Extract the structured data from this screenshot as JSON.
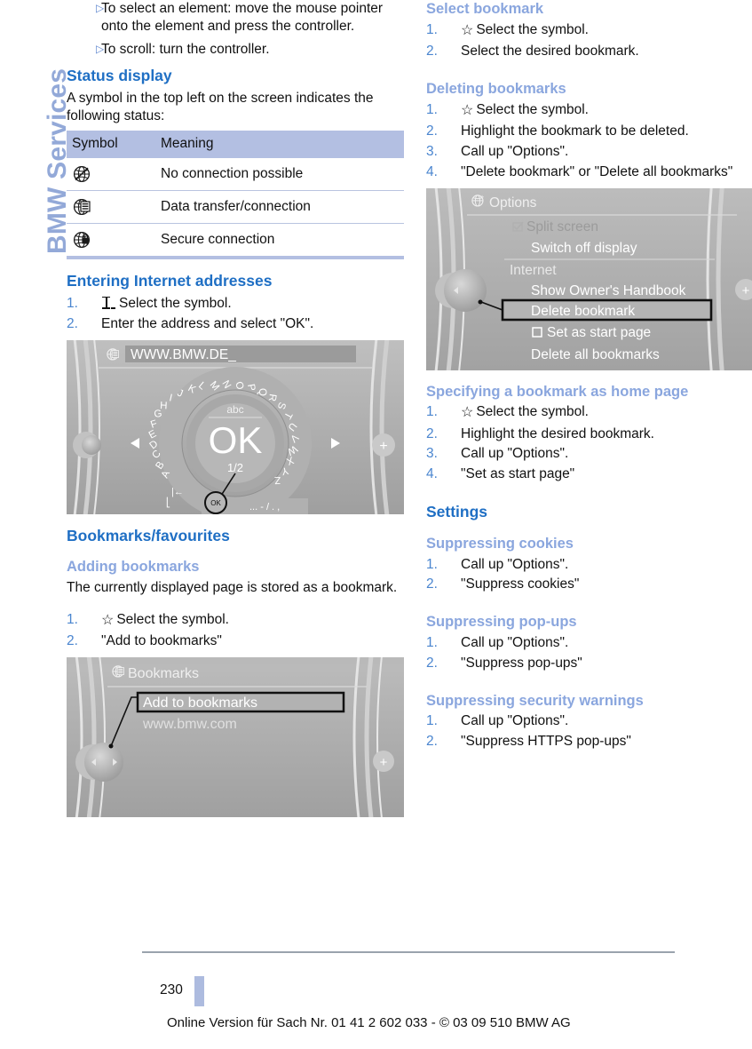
{
  "sidebar": {
    "chapter_label": "BMW Services"
  },
  "left_column": {
    "intro_bullets": [
      "To select an element: move the mouse pointer onto the element and press the controller.",
      "To scroll: turn the controller."
    ],
    "status_display": {
      "heading": "Status display",
      "intro": "A symbol in the top left on the screen indicates the following status:",
      "table": {
        "headers": [
          "Symbol",
          "Meaning"
        ],
        "rows": [
          {
            "symbol_icon": "globe-no-connection-icon",
            "meaning": "No connection possible"
          },
          {
            "symbol_icon": "globe-data-transfer-icon",
            "meaning": "Data transfer/connection"
          },
          {
            "symbol_icon": "globe-secure-icon",
            "meaning": "Secure connection"
          }
        ]
      }
    },
    "entering_addresses": {
      "heading": "Entering Internet addresses",
      "steps": [
        {
          "symbol_icon": "i-beam-cursor-icon",
          "text": "Select the symbol."
        },
        {
          "symbol_icon": null,
          "text": "Enter the address and select \"OK\"."
        }
      ]
    },
    "speller_screen": {
      "title": "WWW.BMW.DE_",
      "title_icon": "globe-data-transfer-icon",
      "center_label": "OK",
      "mode_label": "abc",
      "page_indicator": "1/2",
      "letters": [
        "A",
        "B",
        "C",
        "D",
        "E",
        "F",
        "G",
        "H",
        "I",
        "J",
        "K",
        "L",
        "M",
        "N",
        "O",
        "P",
        "Q",
        "R",
        "S",
        "T",
        "U",
        "V",
        "W",
        "X",
        "Y",
        "Z"
      ],
      "extra_symbols": "... - / . ,",
      "callout_label": "OK"
    },
    "bookmarks": {
      "heading": "Bookmarks/favourites",
      "adding": {
        "heading": "Adding bookmarks",
        "intro": "The currently displayed page is stored as a bookmark.",
        "steps": [
          {
            "symbol_icon": "star-icon",
            "text": "Select the symbol."
          },
          {
            "symbol_icon": null,
            "text": "\"Add to bookmarks\""
          }
        ]
      }
    },
    "bookmarks_screen": {
      "title": "Bookmarks",
      "title_icon": "globe-data-transfer-icon",
      "items": [
        {
          "label": "Add to bookmarks",
          "highlighted": true
        },
        {
          "label": "www.bmw.com",
          "highlighted": false
        }
      ]
    }
  },
  "right_column": {
    "select_bookmark": {
      "heading": "Select bookmark",
      "steps": [
        {
          "symbol_icon": "star-icon",
          "text": "Select the symbol."
        },
        {
          "symbol_icon": null,
          "text": "Select the desired bookmark."
        }
      ]
    },
    "deleting_bookmarks": {
      "heading": "Deleting bookmarks",
      "steps": [
        {
          "symbol_icon": "star-icon",
          "text": "Select the symbol."
        },
        {
          "symbol_icon": null,
          "text": "Highlight the bookmark to be deleted."
        },
        {
          "symbol_icon": null,
          "text": "Call up \"Options\"."
        },
        {
          "symbol_icon": null,
          "text": "\"Delete bookmark\" or \"Delete all bookmarks\""
        }
      ]
    },
    "options_screen": {
      "title": "Options",
      "title_icon": "globe-plus-icon",
      "items": [
        {
          "label": "Split screen",
          "dimmed": true,
          "checkbox": "checked",
          "highlighted": false
        },
        {
          "label": "Switch off display",
          "dimmed": false,
          "checkbox": null,
          "highlighted": false
        },
        {
          "label": "Internet",
          "dimmed": false,
          "checkbox": null,
          "highlighted": false,
          "is_group": true
        },
        {
          "label": "Show Owner's Handbook",
          "dimmed": false,
          "checkbox": null,
          "highlighted": false
        },
        {
          "label": "Delete bookmark",
          "dimmed": false,
          "checkbox": null,
          "highlighted": true
        },
        {
          "label": "Set as start page",
          "dimmed": false,
          "checkbox": "unchecked",
          "highlighted": false
        },
        {
          "label": "Delete all bookmarks",
          "dimmed": false,
          "checkbox": null,
          "highlighted": false
        }
      ]
    },
    "home_page": {
      "heading": "Specifying a bookmark as home page",
      "steps": [
        {
          "symbol_icon": "star-icon",
          "text": "Select the symbol."
        },
        {
          "symbol_icon": null,
          "text": "Highlight the desired bookmark."
        },
        {
          "symbol_icon": null,
          "text": "Call up \"Options\"."
        },
        {
          "symbol_icon": null,
          "text": "\"Set as start page\""
        }
      ]
    },
    "settings": {
      "heading": "Settings",
      "cookies": {
        "heading": "Suppressing cookies",
        "steps": [
          {
            "symbol_icon": null,
            "text": "Call up \"Options\"."
          },
          {
            "symbol_icon": null,
            "text": "\"Suppress cookies\""
          }
        ]
      },
      "popups": {
        "heading": "Suppressing pop-ups",
        "steps": [
          {
            "symbol_icon": null,
            "text": "Call up \"Options\"."
          },
          {
            "symbol_icon": null,
            "text": "\"Suppress pop-ups\""
          }
        ]
      },
      "security": {
        "heading": "Suppressing security warnings",
        "steps": [
          {
            "symbol_icon": null,
            "text": "Call up \"Options\"."
          },
          {
            "symbol_icon": null,
            "text": "\"Suppress HTTPS pop-ups\""
          }
        ]
      }
    }
  },
  "footer": {
    "page_number": "230",
    "online_version": "Online Version für Sach Nr. 01 41 2 602 033 - © 03 09 510 BMW AG"
  },
  "colors": {
    "heading_blue": "#1f6fc4",
    "subheading_blue": "#8aa6de",
    "list_number_blue": "#4a85cf",
    "table_header_bg": "#b3bfe2",
    "tab_blue": "#adbbdf",
    "sidebar_text": "#93a9d8"
  }
}
